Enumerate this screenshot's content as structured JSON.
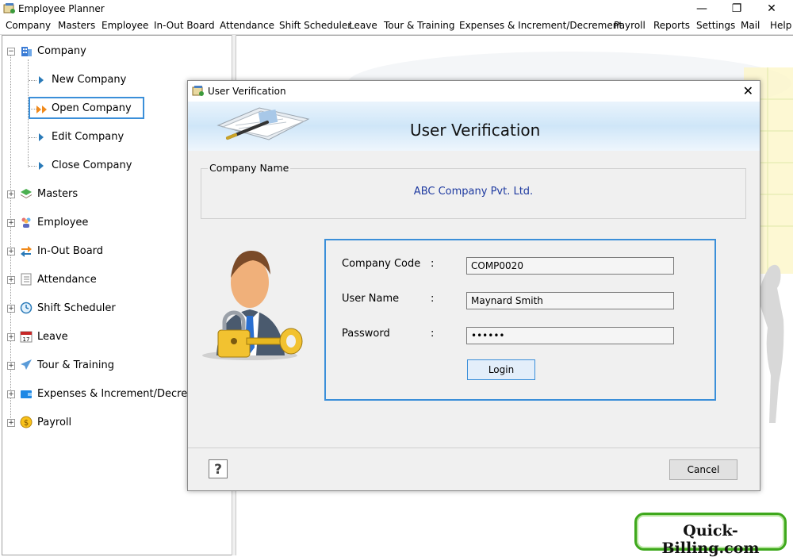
{
  "app": {
    "title": "Employee Planner"
  },
  "window_controls": {
    "minimize": "—",
    "maximize": "❐",
    "close": "✕"
  },
  "menu": [
    "Company",
    "Masters",
    "Employee",
    "In-Out Board",
    "Attendance",
    "Shift Scheduler",
    "Leave",
    "Tour & Training",
    "Expenses & Increment/Decrement",
    "Payroll",
    "Reports",
    "Settings",
    "Mail",
    "Help"
  ],
  "tree": {
    "root_company": "Company",
    "company_children": [
      "New Company",
      "Open Company",
      "Edit Company",
      "Close Company"
    ],
    "selected_child": "Open Company",
    "nodes": [
      "Masters",
      "Employee",
      "In-Out Board",
      "Attendance",
      "Shift Scheduler",
      "Leave",
      "Tour & Training",
      "Expenses & Increment/Decrement",
      "Payroll"
    ],
    "leave_icon_text": "17"
  },
  "dialog": {
    "title": "User Verification",
    "close_label": "✕",
    "heading": "User Verification",
    "company_group_label": "Company Name",
    "company_name": "ABC Company Pvt. Ltd.",
    "fields": {
      "company_code_label": "Company Code",
      "company_code_value": "COMP0020",
      "user_name_label": "User Name",
      "user_name_value": "Maynard Smith",
      "password_label": "Password",
      "password_value": "••••••",
      "separator": ":"
    },
    "login_label": "Login",
    "help_label": "?",
    "cancel_label": "Cancel"
  },
  "badge": {
    "text": "Quick-Billing.com"
  },
  "colors": {
    "accent": "#3b8fd9",
    "company_name_text": "#1e3aa0",
    "badge_border": "#3ea81c"
  }
}
